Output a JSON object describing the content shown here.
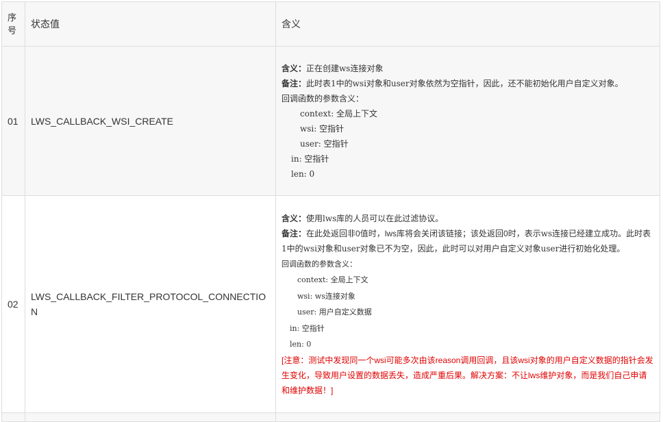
{
  "table": {
    "headers": [
      "序号",
      "状态值",
      "含义"
    ],
    "rows": [
      {
        "num": "01",
        "state": "LWS_CALLBACK_WSI_CREATE",
        "meaning_label": "含义：",
        "meaning": "正在创建ws连接对象",
        "note_label": "备注：",
        "note": "此时表1中的wsi对象和user对象依然为空指针，因此，还不能初始化用户自定义对象。",
        "params_title": "回调函数的参数含义：",
        "params": [
          "context: 全局上下文",
          "wsi: 空指针",
          "user: 空指针"
        ],
        "params2": [
          "in: 空指针",
          "len: 0"
        ]
      },
      {
        "num": "02",
        "state": "LWS_CALLBACK_FILTER_PROTOCOL_CONNECTION",
        "meaning_label": "含义：",
        "meaning": "使用lws库的人员可以在此过滤协议。",
        "note_label": "备注：",
        "note_a": "在此处返回非0值时，lws库将会关闭该链接；该处返回0时，",
        "note_b": "表示ws连接已经建立成功。此时表1中的wsi对象和user对象已不为空，因此，此时可以对用户自定义对象user进行初始化处理。",
        "params_title": "回调函数的参数含义：",
        "params": [
          "context: 全局上下文",
          "wsi: ws连接对象",
          "user: 用户自定义数据"
        ],
        "params2": [
          "in: 空指针",
          "len: 0"
        ],
        "warning": "[注意：测试中发现同一个wsi可能多次由该reason调用回调，且该wsi对象的用户自定义数据的指针会发生变化，导致用户设置的数据丢失，造成严重后果。解决方案：不让lws维护对象，而是我们自己申请和维护数据！]"
      }
    ]
  },
  "colors": {
    "header_bg": "#f7f7f7",
    "border": "#dddddd",
    "warning": "#e00000"
  }
}
